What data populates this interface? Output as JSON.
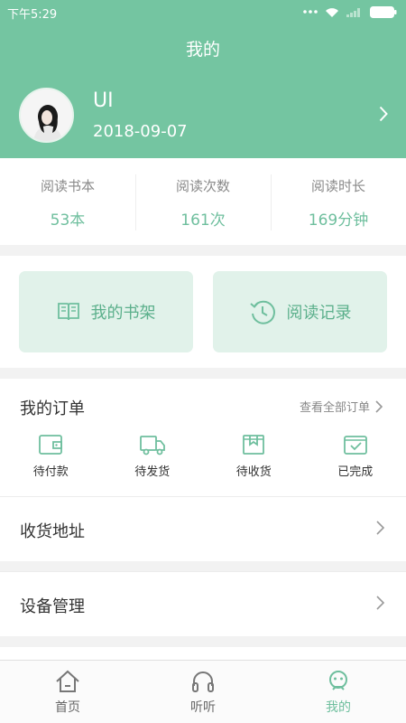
{
  "status_bar": {
    "time": "下午5:29"
  },
  "header": {
    "title": "我的"
  },
  "profile": {
    "name": "UI",
    "date": "2018-09-07"
  },
  "stats": [
    {
      "label": "阅读书本",
      "value": "53本"
    },
    {
      "label": "阅读次数",
      "value": "161次"
    },
    {
      "label": "阅读时长",
      "value": "169分钟"
    }
  ],
  "quick": {
    "bookshelf": "我的书架",
    "history": "阅读记录"
  },
  "orders": {
    "title": "我的订单",
    "view_all": "查看全部订单",
    "items": [
      {
        "label": "待付款",
        "icon": "wallet-icon"
      },
      {
        "label": "待发货",
        "icon": "truck-icon"
      },
      {
        "label": "待收货",
        "icon": "package-icon"
      },
      {
        "label": "已完成",
        "icon": "completed-icon"
      }
    ]
  },
  "rows": {
    "address": "收货地址",
    "device": "设备管理"
  },
  "tabs": [
    {
      "label": "首页",
      "icon": "home-icon"
    },
    {
      "label": "听听",
      "icon": "headphones-icon"
    },
    {
      "label": "我的",
      "icon": "profile-face-icon"
    }
  ],
  "colors": {
    "accent": "#74c5a1",
    "accent_text": "#6fbf9e",
    "tile_bg": "#e1f2ea"
  }
}
